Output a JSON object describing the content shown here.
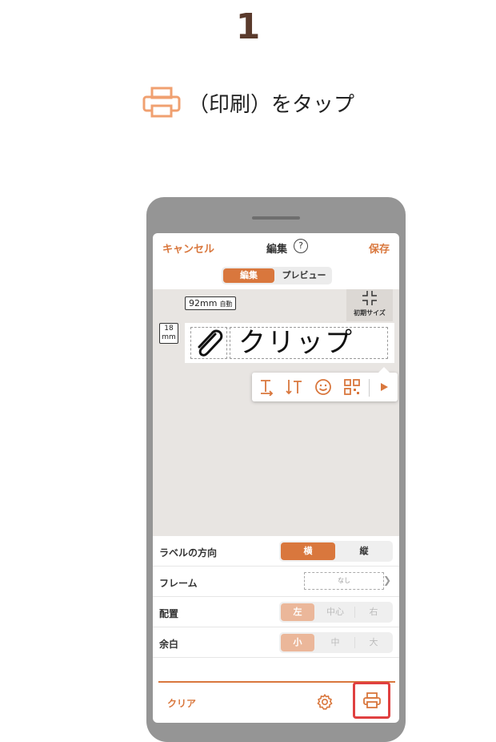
{
  "header": {
    "step_number": "1",
    "instruction": "（印刷）をタップ"
  },
  "nav": {
    "cancel_label": "キャンセル",
    "title": "編集",
    "help_icon": "?",
    "save_label": "保存"
  },
  "mode_tabs": {
    "edit_label": "編集",
    "preview_label": "プレビュー",
    "selected": "編集"
  },
  "canvas": {
    "width_value": "92mm",
    "width_mode": "自動",
    "height_value": "18",
    "height_unit": "mm",
    "reset_size_label": "初期サイズ",
    "label_text": "クリップ"
  },
  "toolbar": {
    "icons": [
      "text-add-icon",
      "vertical-text-icon",
      "emoji-icon",
      "qr-code-icon",
      "play-more-icon"
    ]
  },
  "settings": {
    "orientation": {
      "label": "ラベルの方向",
      "options": [
        "横",
        "縦"
      ],
      "selected": "横"
    },
    "frame": {
      "label": "フレーム",
      "value": "なし"
    },
    "alignment": {
      "label": "配置",
      "options": [
        "左",
        "中心",
        "右"
      ],
      "selected": "左"
    },
    "margin": {
      "label": "余白",
      "options": [
        "小",
        "中",
        "大"
      ],
      "selected": "小"
    }
  },
  "bottom_bar": {
    "clear_label": "クリア"
  },
  "colors": {
    "accent": "#d9773d",
    "highlight": "#e04040",
    "step_number": "#5a3a2c",
    "instruction_icon": "#f0a070"
  }
}
